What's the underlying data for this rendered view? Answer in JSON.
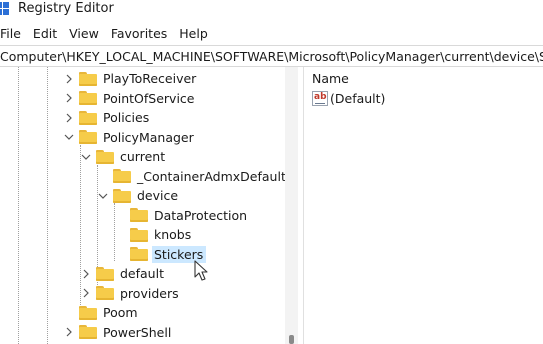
{
  "window": {
    "title": "Registry Editor"
  },
  "menu": [
    "File",
    "Edit",
    "View",
    "Favorites",
    "Help"
  ],
  "address": {
    "path": "Computer\\HKEY_LOCAL_MACHINE\\SOFTWARE\\Microsoft\\PolicyManager\\current\\device\\Stickers"
  },
  "tree": [
    {
      "label": "PlayToReceiver",
      "expander": "collapsed"
    },
    {
      "label": "PointOfService",
      "expander": "collapsed"
    },
    {
      "label": "Policies",
      "expander": "collapsed"
    },
    {
      "label": "PolicyManager",
      "expander": "expanded"
    },
    {
      "label": "current",
      "expander": "expanded"
    },
    {
      "label": "_ContainerAdmxDefault",
      "expander": "none"
    },
    {
      "label": "device",
      "expander": "expanded"
    },
    {
      "label": "DataProtection",
      "expander": "none"
    },
    {
      "label": "knobs",
      "expander": "none"
    },
    {
      "label": "Stickers",
      "expander": "none",
      "selected": true
    },
    {
      "label": "default",
      "expander": "collapsed"
    },
    {
      "label": "providers",
      "expander": "collapsed"
    },
    {
      "label": "Poom",
      "expander": "none"
    },
    {
      "label": "PowerShell",
      "expander": "collapsed"
    }
  ],
  "values_pane": {
    "column_header": "Name",
    "values": [
      {
        "name": "(Default)",
        "icon": "string-value-icon"
      }
    ]
  },
  "colors": {
    "selection": "#cce8ff",
    "folder": "#f6cc4a",
    "accent": "#2b6fd6"
  }
}
